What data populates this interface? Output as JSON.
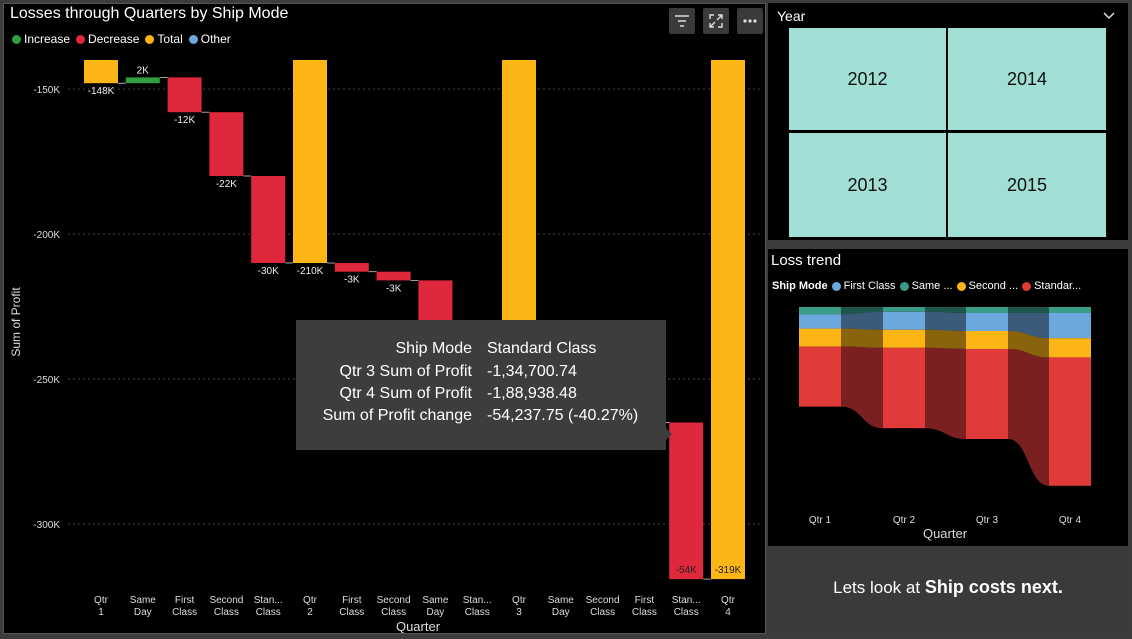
{
  "main_chart": {
    "title": "Losses through Quarters by Ship Mode",
    "legend": [
      {
        "label": "Increase",
        "color": "#2ea043"
      },
      {
        "label": "Decrease",
        "color": "#e0283c"
      },
      {
        "label": "Total",
        "color": "#fbb615"
      },
      {
        "label": "Other",
        "color": "#6aa8de"
      }
    ],
    "toolbar": {
      "filter_icon": "filter-icon",
      "focus_icon": "focus-mode-icon",
      "more_icon": "more-options-icon"
    }
  },
  "tooltip": {
    "rows": [
      {
        "key": "Ship Mode",
        "value": "Standard Class"
      },
      {
        "key": "Qtr 3 Sum of Profit",
        "value": "-1,34,700.74"
      },
      {
        "key": "Qtr 4 Sum of Profit",
        "value": "-1,88,938.48"
      },
      {
        "key": "Sum of Profit change",
        "value": "-54,237.75 (-40.27%)"
      }
    ]
  },
  "year_slicer": {
    "title": "Year",
    "options": [
      "2012",
      "2014",
      "2013",
      "2015"
    ]
  },
  "trend_chart": {
    "title": "Loss trend",
    "legend_title": "Ship Mode",
    "legend": [
      {
        "label": "First Class",
        "color": "#6aa8de"
      },
      {
        "label": "Same ...",
        "color": "#3a9b86"
      },
      {
        "label": "Second ...",
        "color": "#fbb615"
      },
      {
        "label": "Standar...",
        "color": "#e03a3a"
      }
    ]
  },
  "note": {
    "prefix": "Lets look at",
    "bold": "Ship costs next."
  },
  "chart_data": [
    {
      "type": "bar",
      "subtype": "waterfall",
      "title": "Losses through Quarters by Ship Mode",
      "xlabel": "Quarter",
      "ylabel": "Sum of Profit",
      "yticks": [
        "-150K",
        "-200K",
        "-250K",
        "-300K"
      ],
      "ylim": [
        -320000,
        -140000
      ],
      "categories": [
        "Qtr 1",
        "Same Day",
        "First Class",
        "Second Class",
        "Stan... Class",
        "Qtr 2",
        "First Class",
        "Second Class",
        "Same Day",
        "Stan... Class",
        "Qtr 3",
        "Same Day",
        "Second Class",
        "First Class",
        "Stan... Class",
        "Qtr 4"
      ],
      "bars": [
        {
          "category": "Qtr 1",
          "kind": "total",
          "start": -140000,
          "end": -148000,
          "label": "-148K"
        },
        {
          "category": "Same Day",
          "kind": "increase",
          "start": -148000,
          "end": -146000,
          "label": "2K"
        },
        {
          "category": "First Class",
          "kind": "decrease",
          "start": -146000,
          "end": -158000,
          "label": "-12K"
        },
        {
          "category": "Second Class",
          "kind": "decrease",
          "start": -158000,
          "end": -180000,
          "label": "-22K"
        },
        {
          "category": "Stan... Class",
          "kind": "decrease",
          "start": -180000,
          "end": -210000,
          "label": "-30K"
        },
        {
          "category": "Qtr 2",
          "kind": "total",
          "start": -140000,
          "end": -210000,
          "label": "-210K"
        },
        {
          "category": "First Class",
          "kind": "decrease",
          "start": -210000,
          "end": -213000,
          "label": "-3K"
        },
        {
          "category": "Second Class",
          "kind": "decrease",
          "start": -213000,
          "end": -216000,
          "label": "-3K"
        },
        {
          "category": "Same Day",
          "kind": "decrease",
          "start": -216000,
          "end": -232000,
          "label": ""
        },
        {
          "category": "Stan... Class",
          "kind": "decrease",
          "start": -232000,
          "end": -265000,
          "label": ""
        },
        {
          "category": "Qtr 3",
          "kind": "total",
          "start": -140000,
          "end": -265000,
          "label": ""
        },
        {
          "category": "Same Day",
          "kind": "decrease",
          "start": -265000,
          "end": -265000,
          "label": ""
        },
        {
          "category": "Second Class",
          "kind": "decrease",
          "start": -265000,
          "end": -265000,
          "label": ""
        },
        {
          "category": "First Class",
          "kind": "decrease",
          "start": -265000,
          "end": -265000,
          "label": ""
        },
        {
          "category": "Stan... Class",
          "kind": "decrease",
          "start": -265000,
          "end": -319000,
          "label": "-54K"
        },
        {
          "category": "Qtr 4",
          "kind": "total",
          "start": -140000,
          "end": -319000,
          "label": "-319K"
        }
      ]
    },
    {
      "type": "area",
      "subtype": "ribbon",
      "title": "Loss trend",
      "xlabel": "Quarter",
      "categories": [
        "Qtr 1",
        "Qtr 2",
        "Qtr 3",
        "Qtr 4"
      ],
      "series": [
        {
          "name": "Standar...",
          "values": [
            50,
            67,
            75,
            107
          ]
        },
        {
          "name": "Second ...",
          "values": [
            15,
            15,
            15,
            16
          ]
        },
        {
          "name": "First Class",
          "values": [
            12,
            15,
            15,
            21
          ]
        },
        {
          "name": "Same ...",
          "values": [
            6,
            4,
            5,
            5
          ]
        }
      ]
    }
  ]
}
